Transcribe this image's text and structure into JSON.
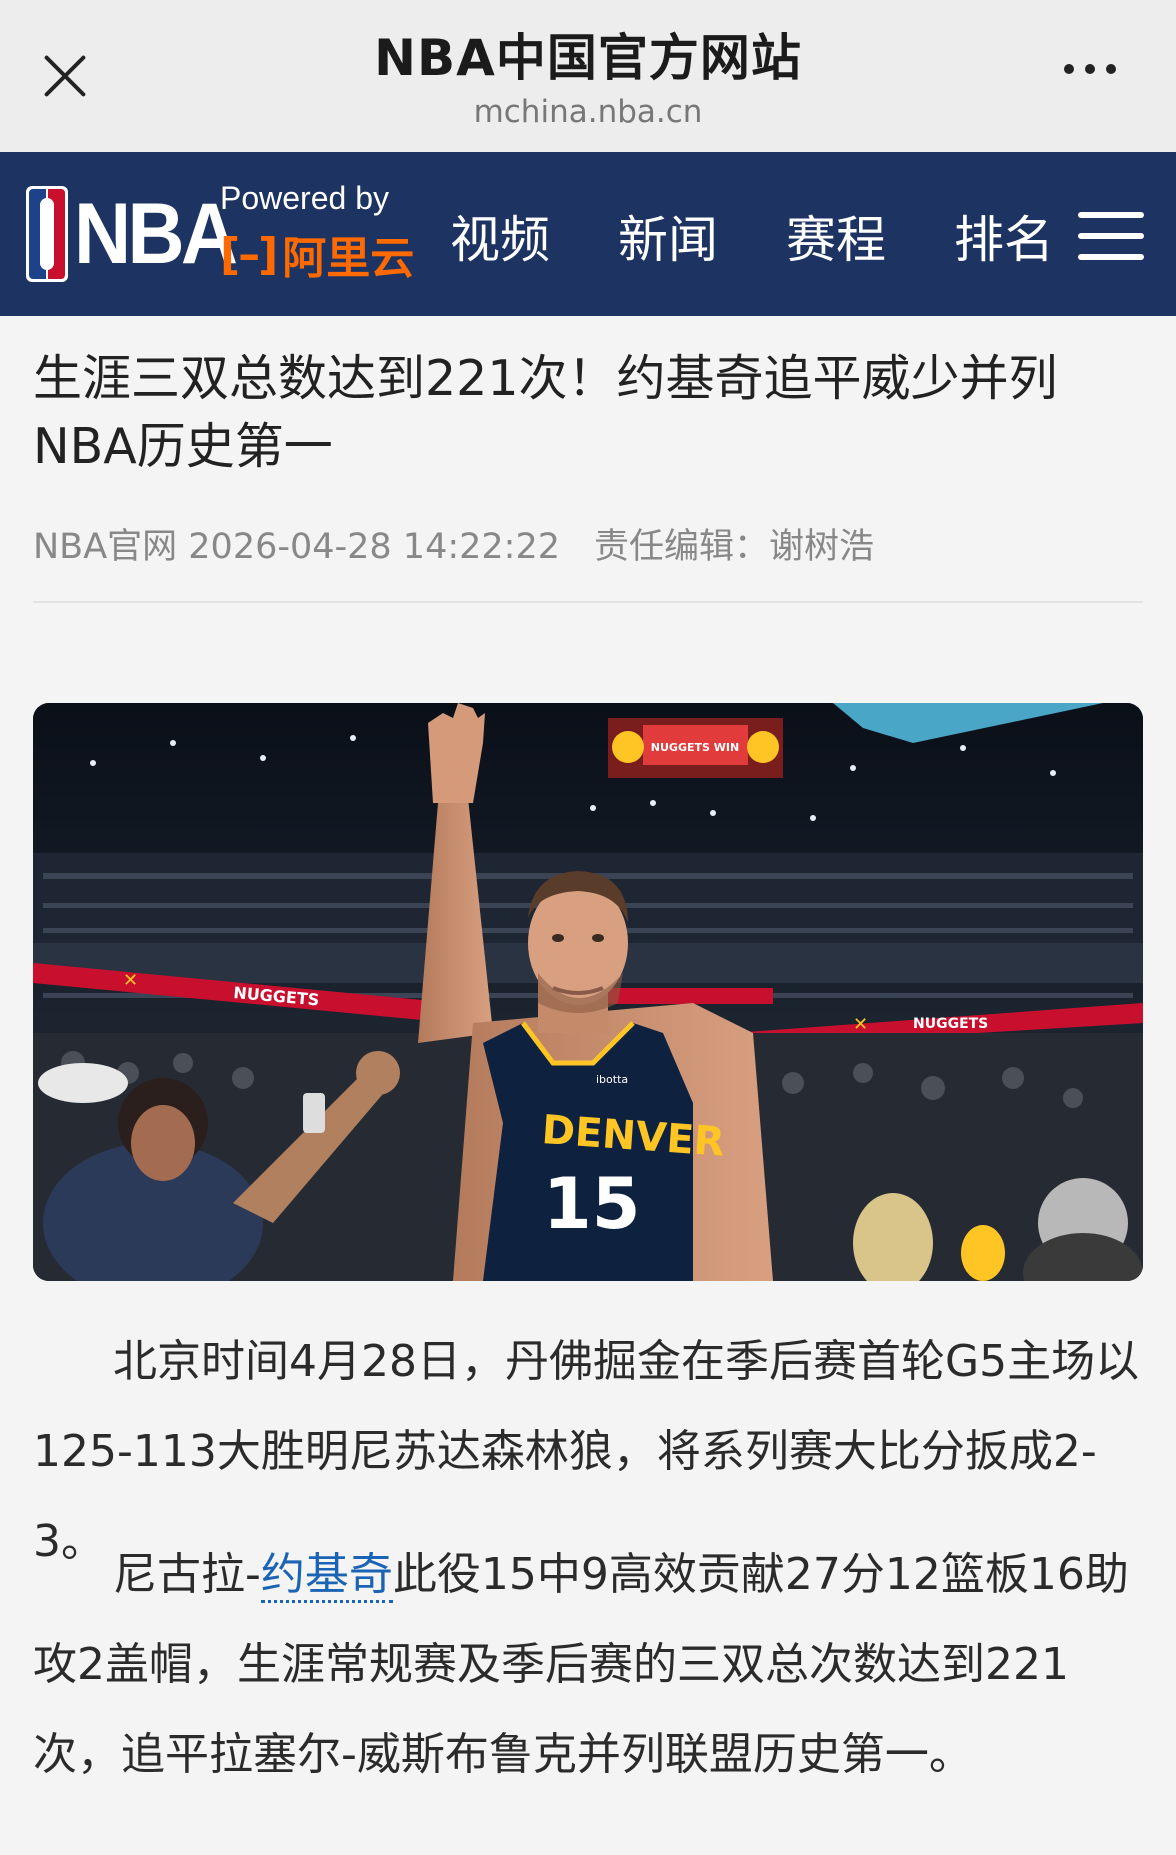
{
  "browser": {
    "title": "NBA中国官方网站",
    "url": "mchina.nba.cn"
  },
  "nav": {
    "logo_text": "NBA",
    "powered_by": "Powered by",
    "sponsor": "阿里云",
    "items": [
      {
        "label": "视频"
      },
      {
        "label": "新闻"
      },
      {
        "label": "赛程"
      },
      {
        "label": "排名"
      }
    ]
  },
  "article": {
    "title": "生涯三双总数达到221次！约基奇追平威少并列NBA历史第一",
    "source": "NBA官网",
    "datetime": "2026-04-28 14:22:22",
    "editor": "责任编辑：谢树浩",
    "photo": {
      "jersey_team": "DENVER",
      "jersey_number": "15",
      "jersey_sponsor": "ibotta",
      "arena_banner": "NUGGETS",
      "scoreboard_text": "NUGGETS WIN"
    },
    "para1": "北京时间4月28日，丹佛掘金在季后赛首轮G5主场以125-113大胜明尼苏达森林狼，将系列赛大比分扳成2-3。",
    "para2_prefix": "尼古拉-",
    "para2_link": "约基奇",
    "para2_rest": "此役15中9高效贡献27分12篮板16助攻2盖帽，生涯常规赛及季后赛的三双总次数达到221次，追平拉塞尔-威斯布鲁克并列联盟历史第一。"
  },
  "colors": {
    "nav_bg": "#1d3361",
    "accent_orange": "#ff6a00",
    "link_blue": "#1a63b5",
    "nuggets_navy": "#0e2240",
    "nuggets_gold": "#fec524",
    "nuggets_red": "#c8102e"
  },
  "icons": {
    "close": "close-icon",
    "more": "more-dots-icon",
    "menu": "hamburger-menu-icon"
  }
}
